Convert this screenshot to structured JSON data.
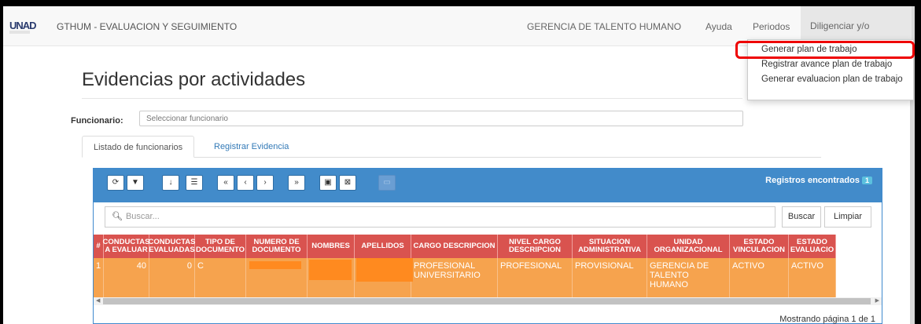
{
  "navbar": {
    "logo": "UNAD",
    "app_title": "GTHUM - EVALUACION Y SEGUIMIENTO",
    "links": [
      "GERENCIA DE TALENTO HUMANO",
      "Ayuda",
      "Periodos"
    ],
    "active_menu": "Diligenciar y/o reportes"
  },
  "dropdown": {
    "items": [
      "Generar plan de trabajo",
      "Registrar avance plan de trabajo",
      "Generar evaluacion plan de trabajo"
    ],
    "highlight_color": "#e00000"
  },
  "page": {
    "title": "Evidencias por actividades",
    "funcionario_label": "Funcionario:",
    "funcionario_placeholder": "Seleccionar funcionario"
  },
  "tabs": [
    "Listado de funcionarios",
    "Registrar Evidencia"
  ],
  "grid": {
    "toolbar_icons": [
      "refresh-icon",
      "filter-icon",
      "sort-icon",
      "list-icon",
      "first-page-icon",
      "prev-page-icon",
      "next-page-icon",
      "last-page-icon",
      "pdf-icon",
      "excel-icon",
      "disabled-export-icon"
    ],
    "toolbar_glyphs": [
      "⟳",
      "▼",
      "↓",
      "☰",
      "«",
      "‹",
      "›",
      "»",
      "▣",
      "⊠",
      "▭"
    ],
    "records_label": "Registros encontrados",
    "records_count": "1",
    "search_placeholder": "Buscar...",
    "search_button": "Buscar",
    "clear_button": "Limpiar",
    "columns": [
      "#",
      "CONDUCTAS A EVALUAR",
      "CONDUCTAS EVALUADAS",
      "TIPO DE DOCUMENTO",
      "NUMERO DE DOCUMENTO",
      "NOMBRES",
      "APELLIDOS",
      "CARGO DESCRIPCION",
      "NIVEL CARGO DESCRIPCION",
      "SITUACION ADMINISTRATIVA",
      "UNIDAD ORGANIZACIONAL",
      "ESTADO VINCULACION",
      "ESTADO EVALUACIO"
    ],
    "row": {
      "num": "1",
      "conductas_evaluar": "40",
      "conductas_evaluadas": "0",
      "tipo_documento": "C",
      "cargo": "PROFESIONAL UNIVERSITARIO",
      "nivel": "PROFESIONAL",
      "situacion": "PROVISIONAL",
      "unidad": "GERENCIA DE TALENTO HUMANO",
      "estado_vinculacion": "ACTIVO",
      "estado_evaluacion": "ACTIVO"
    },
    "pagination_text": "Mostrando página 1 de 1",
    "colors": {
      "header": "#428bca",
      "table_header": "#d9534f",
      "row": "#f6a34e"
    }
  }
}
